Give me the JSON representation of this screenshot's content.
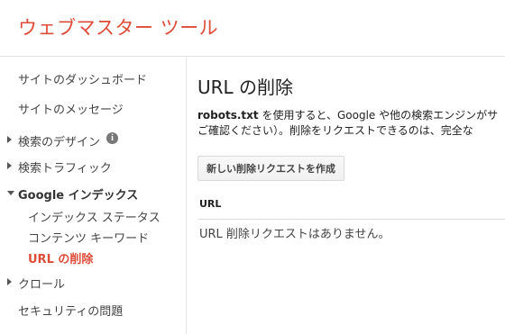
{
  "app": {
    "title": "ウェブマスター ツール"
  },
  "sidebar": {
    "items": [
      {
        "label": "サイトのダッシュボード"
      },
      {
        "label": "サイトのメッセージ"
      },
      {
        "label": "検索のデザイン",
        "info_icon": "info-icon"
      },
      {
        "label": "検索トラフィック"
      },
      {
        "label": "Google インデックス",
        "children": [
          {
            "label": "インデックス ステータス"
          },
          {
            "label": "コンテンツ キーワード"
          },
          {
            "label": "URL の削除",
            "active": true
          }
        ]
      },
      {
        "label": "クロール"
      },
      {
        "label": "セキュリティの問題"
      }
    ]
  },
  "main": {
    "title": "URL の削除",
    "desc": {
      "bold": "robots.txt",
      "line1_rest": " を使用すると、Google や他の検索エンジンがサ",
      "line2": "ご確認ください）。削除をリクエストできるのは、完全な"
    },
    "new_request_button": "新しい削除リクエストを作成",
    "table": {
      "header": "URL",
      "empty": "URL 削除リクエストはありません。"
    }
  },
  "colors": {
    "brand": "#dd4b39",
    "text": "#222222",
    "border": "#e5e5e5"
  }
}
